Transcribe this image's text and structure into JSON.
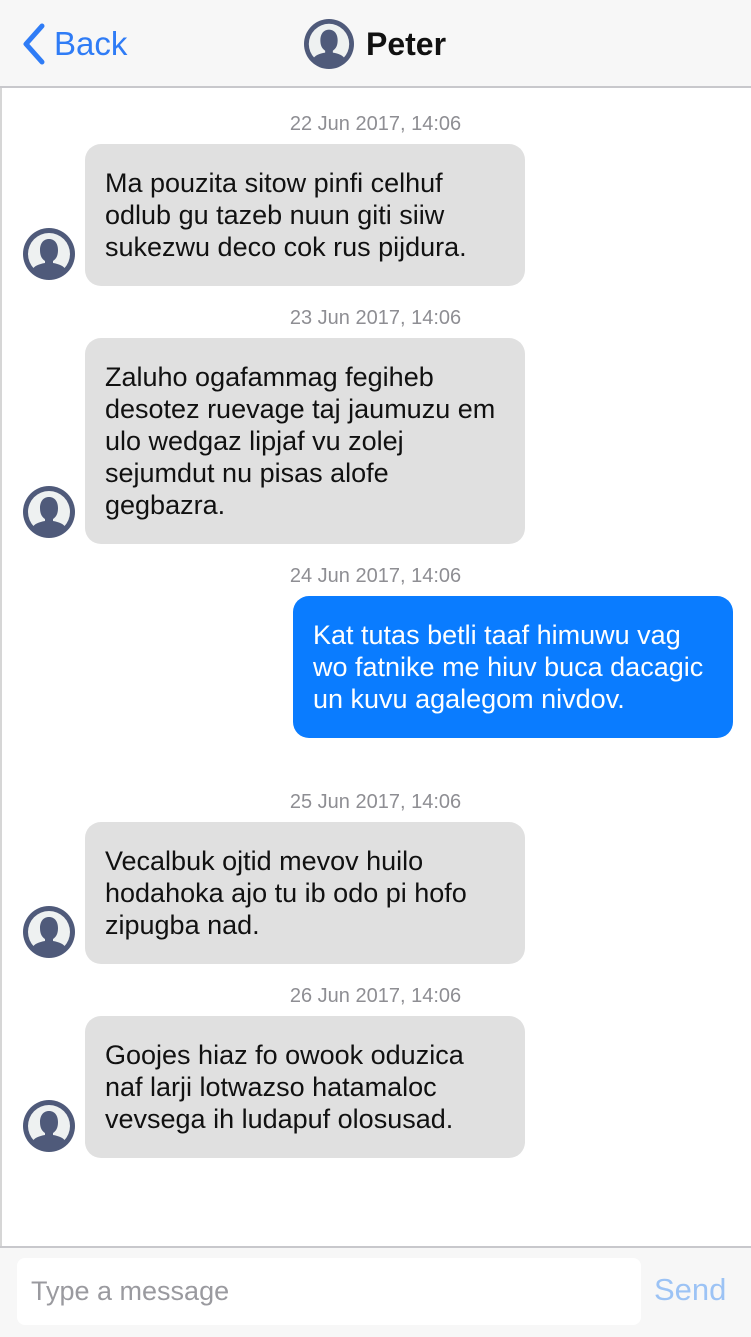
{
  "header": {
    "back_label": "Back",
    "contact_name": "Peter",
    "back_icon": "chevron-left-icon",
    "avatar_icon": "person-avatar-icon"
  },
  "messages": [
    {
      "timestamp": "22 Jun 2017, 14:06",
      "direction": "incoming",
      "text": "Ma pouzita sitow pinfi celhuf odlub gu tazeb nuun giti siiw sukezwu deco cok rus pijdura."
    },
    {
      "timestamp": "23 Jun 2017, 14:06",
      "direction": "incoming",
      "text": "Zaluho ogafammag fegiheb desotez ruevage taj jaumuzu em ulo wedgaz lipjaf vu zolej sejumdut nu pisas alofe gegbazra."
    },
    {
      "timestamp": "24 Jun 2017, 14:06",
      "direction": "outgoing",
      "text": "Kat tutas betli taaf himuwu vag wo fatnike me hiuv buca dacagic un kuvu agalegom nivdov."
    },
    {
      "timestamp": "25 Jun 2017, 14:06",
      "direction": "incoming",
      "text": "Vecalbuk ojtid mevov huilo hodahoka ajo tu ib odo pi hofo zipugba nad."
    },
    {
      "timestamp": "26 Jun 2017, 14:06",
      "direction": "incoming",
      "text": "Goojes hiaz fo owook oduzica naf larji lotwazso hatamaloc vevsega ih ludapuf olosusad."
    }
  ],
  "composer": {
    "placeholder": "Type a message",
    "value": "",
    "send_label": "Send"
  },
  "colors": {
    "accent": "#2f7cf6",
    "outgoing_bubble": "#0a7cff",
    "incoming_bubble": "#e0e0e0",
    "send_disabled": "#9cc3f5",
    "avatar": "#4f5a7a"
  }
}
